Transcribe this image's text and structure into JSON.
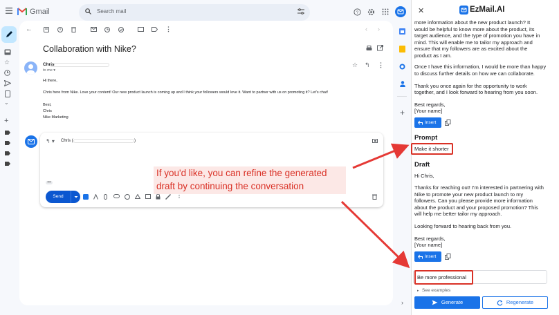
{
  "gmail": {
    "app_name": "Gmail",
    "search_placeholder": "Search mail",
    "subject": "Collaboration with Nike?",
    "sender_name": "Chris",
    "to_me": "to me",
    "body": [
      "Hi there,",
      "Chris here from Nike. Love your content! Our new product launch is coming up and I think your followers would love it. Want to partner with us on promoting it? Let's chat!",
      "Best,",
      "Chris",
      "Nike Marketing"
    ],
    "reply_to": "Chris (",
    "reply_to_close": ")",
    "ellipsis": "•••",
    "send_label": "Send"
  },
  "annotation": {
    "line1": "If you'd like, you can refine the generated",
    "line2": "draft by continuing the conversation",
    "color": "#d93025"
  },
  "panel": {
    "brand": "EzMail.AI",
    "prev_lines": [
      "more information about the new product launch? It",
      "would be helpful to know more about the product, its",
      "target audience, and the type of promotion you have in",
      "mind. This will enable me to tailor my approach and",
      "ensure that my followers are as excited about the",
      "product as I am."
    ],
    "prev_lines2": [
      "Once I have this information, I would be more than happy",
      "to discuss further details on how we can collaborate."
    ],
    "prev_lines3": [
      "Thank you once again for the opportunity to work",
      "together, and I look forward to hearing from you soon."
    ],
    "prev_sign": [
      "Best regards,",
      "[Your name]"
    ],
    "insert_label": "Insert",
    "prompt_heading": "Prompt",
    "prompt_text": "Make it shorter",
    "draft_heading": "Draft",
    "draft_greeting": "Hi Chris,",
    "draft_lines": [
      "Thanks for reaching out! I'm interested in partnering with",
      "Nike to promote your new product launch to my",
      "followers. Can you please provide more information",
      "about the product and your proposed promotion? This",
      "will help me better tailor my approach."
    ],
    "draft_closing": "Looking forward to hearing back from you.",
    "draft_sign": [
      "Best regards,",
      "[Your name]"
    ],
    "input_value": "Be more professional",
    "see_examples": "See examples",
    "generate_label": "Generate",
    "regenerate_label": "Regenerate",
    "accent": "#1a73e8"
  }
}
